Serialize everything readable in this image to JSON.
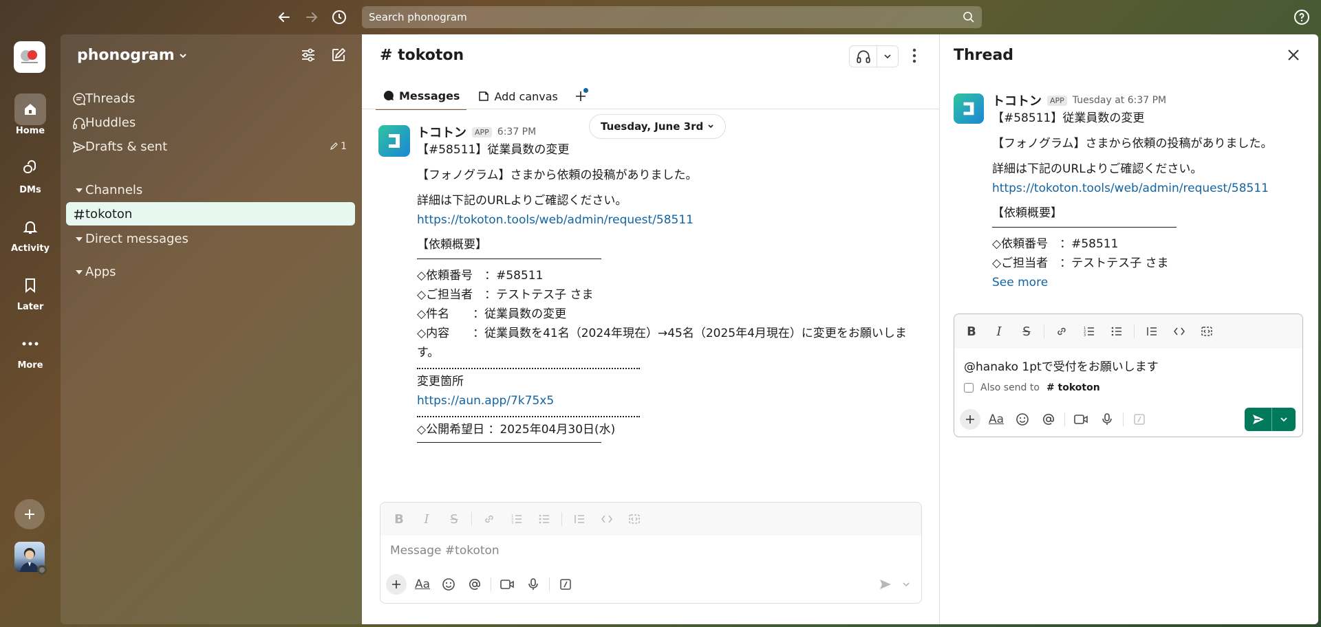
{
  "search": {
    "placeholder": "Search phonogram"
  },
  "rail": {
    "items": [
      {
        "label": "Home"
      },
      {
        "label": "DMs"
      },
      {
        "label": "Activity"
      },
      {
        "label": "Later"
      },
      {
        "label": "More"
      }
    ]
  },
  "sidebar": {
    "workspace": "phonogram",
    "items": [
      {
        "label": "Threads"
      },
      {
        "label": "Huddles"
      },
      {
        "label": "Drafts & sent",
        "count": "1"
      }
    ],
    "sections": [
      {
        "label": "Channels"
      },
      {
        "label": "Direct messages"
      },
      {
        "label": "Apps"
      }
    ],
    "channel": "tokoton"
  },
  "channel": {
    "title": "# tokoton",
    "tabs": [
      {
        "label": "Messages"
      },
      {
        "label": "Add canvas"
      }
    ],
    "date_divider": "Tuesday, June 3rd",
    "message": {
      "sender": "トコトン",
      "badge": "APP",
      "time": "6:37 PM",
      "lines": {
        "l1": "【#58511】従業員数の変更",
        "l2": "【フォノグラム】さまから依頼の投稿がありました。",
        "l3": "詳細は下記のURLよりご確認ください。",
        "link1": "https://tokoton.tools/web/admin/request/58511",
        "l4": "【依頼概要】",
        "l5": "◇依頼番号　：#58511",
        "l6": "◇ご担当者　：テストテス子 さま",
        "l7": "◇件名　　：従業員数の変更",
        "l8": "◇内容　　：従業員数を41名（2024年現在）→45名（2025年4月現在）に変更をお願いします。",
        "l9": "変更箇所",
        "link2": "https://aun.app/7k75x5",
        "l10": "◇公開希望日 ：2025年04月30日(水)"
      }
    },
    "composer_placeholder": "Message #tokoton"
  },
  "thread": {
    "title": "Thread",
    "sender": "トコトン",
    "badge": "APP",
    "time": "Tuesday at 6:37 PM",
    "lines": {
      "l1": "【#58511】従業員数の変更",
      "l2": "【フォノグラム】さまから依頼の投稿がありました。",
      "l3": "詳細は下記のURLよりご確認ください。",
      "link1": "https://tokoton.tools/web/admin/request/58511",
      "l4": "【依頼概要】",
      "l5": "◇依頼番号　：#58511",
      "l6": "◇ご担当者　：テストテス子 さま"
    },
    "see_more": "See more",
    "reply_text": "@hanako 1ptで受付をお願いします",
    "also_send_prefix": "Also send to",
    "also_send_channel": "# tokoton"
  },
  "colors": {
    "link": "#1264a3",
    "send_green": "#007a5a",
    "active_channel_bg": "#e6f8ef"
  }
}
